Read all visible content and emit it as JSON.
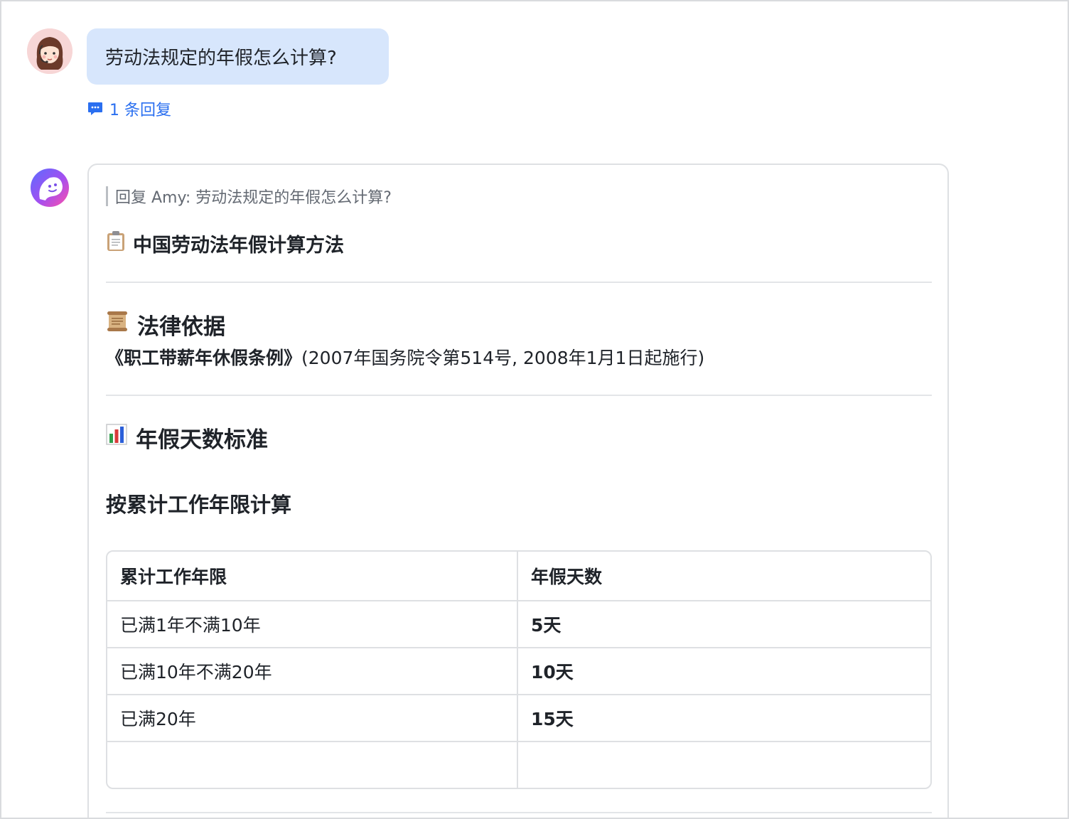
{
  "question": {
    "text": "劳动法规定的年假怎么计算?",
    "reply_link": "1 条回复"
  },
  "answer": {
    "quote": "回复 Amy:  劳动法规定的年假怎么计算?",
    "title": "中国劳动法年假计算方法",
    "sections": {
      "law_heading": "法律依据",
      "law_name": "《职工带薪年休假条例》",
      "law_detail": "(2007年国务院令第514号, 2008年1月1日起施行)",
      "days_heading": "年假天数标准",
      "calc_heading": "按累计工作年限计算"
    },
    "table": {
      "headers": [
        "累计工作年限",
        "年假天数"
      ],
      "rows": [
        [
          "已满1年不满10年",
          "5天"
        ],
        [
          "已满10年不满20年",
          "10天"
        ],
        [
          "已满20年",
          "15天"
        ],
        [
          "",
          ""
        ]
      ]
    }
  },
  "icons": {
    "user_avatar": "user-avatar-icon",
    "bot_avatar": "bot-avatar-icon",
    "reply": "comment-icon",
    "title": "clipboard-icon",
    "law": "scroll-icon",
    "days": "bar-chart-icon"
  },
  "colors": {
    "bubble": "#d7e6fc",
    "link": "#2a6ff0",
    "border": "#dee0e3"
  }
}
